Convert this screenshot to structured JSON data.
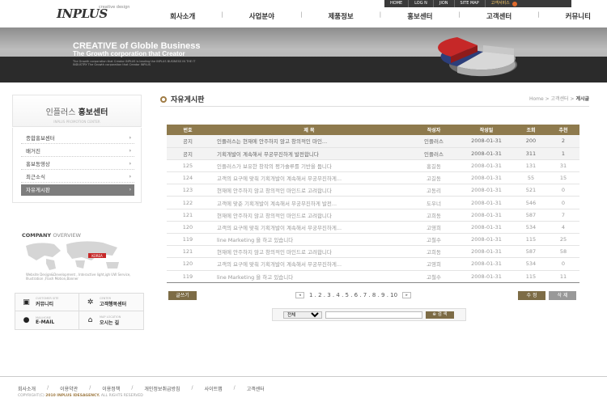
{
  "header": {
    "logo_main": "INPLUS",
    "logo_small": "creative design",
    "util": [
      "HOME",
      "LOG N",
      "JION",
      "SITE MAP",
      "고객서비스"
    ],
    "gnb": [
      "회사소개",
      "사업분야",
      "제품정보",
      "홍보센터",
      "고객센터",
      "커뮤니티"
    ]
  },
  "banner": {
    "title": "CREATIVE of Globle Business",
    "subtitle": "The Growth corporation that Creator",
    "tiny": "The Growth corporation that Creator INPLUS is leading the INPLUS BUSINESS IN THE IT INDUSTRY The Growth corporation that Creator INPLUS"
  },
  "sidebar": {
    "title_light": "인플러스",
    "title_bold": "홍보센터",
    "title_sub": "INPLUS PROMOTION CENTER",
    "items": [
      {
        "label": "종합홍보센터",
        "active": false
      },
      {
        "label": "배거진",
        "active": false
      },
      {
        "label": "홍보동영상",
        "active": false
      },
      {
        "label": "최근소식",
        "active": false
      },
      {
        "label": "자유게시판",
        "active": true
      }
    ],
    "company_bold": "COMPANY",
    "company_light": "OVERVIEW",
    "company_desc": "Website Design&Development , Interactive light,igh UW Service, Illustration ,Flash Motion,Banner",
    "korea_tag": "KOREA",
    "quick": [
      {
        "label": "커뮤니티",
        "sub": "CUSTOMER SITE",
        "icon": "community-icon"
      },
      {
        "label": "고객행복센터",
        "sub": "CENTER",
        "icon": "service-icon"
      },
      {
        "label": "E-MAIL",
        "sub": "MAILHOME",
        "icon": "email-icon"
      },
      {
        "label": "오시는 길",
        "sub": "MAP LOCATION",
        "icon": "home-icon"
      }
    ]
  },
  "main": {
    "title": "자유게시판",
    "breadcrumb": [
      "Home",
      "고객센터",
      "게시글"
    ],
    "columns": [
      "번호",
      "제 목",
      "작성자",
      "작성일",
      "조회",
      "추천"
    ],
    "rows": [
      {
        "no": "공지",
        "subject": "인플러스는 현재에 안주하지 않고 창의적인 마인...",
        "author": "인플러스",
        "date": "2008-01-31",
        "views": "200",
        "rec": "2",
        "notice": true
      },
      {
        "no": "공지",
        "subject": "기획개발이 계속해서 무궁무진하게 발전합니다",
        "author": "인플러스",
        "date": "2008-01-31",
        "views": "311",
        "rec": "1",
        "notice": true
      },
      {
        "no": "125",
        "subject": "인플러스가 보유한 창작의 평가솔루를 기반을 둡니다",
        "author": "홍길동",
        "date": "2008-01-31",
        "views": "131",
        "rec": "31"
      },
      {
        "no": "124",
        "subject": "고객의 요구에 맞춰 기획개발이 계속해서 무궁무진하게...",
        "author": "고길동",
        "date": "2008-01-31",
        "views": "55",
        "rec": "15"
      },
      {
        "no": "123",
        "subject": "현재에 안주하지 않고 창의적인 마인드로 고려합니다",
        "author": "고동리",
        "date": "2008-01-31",
        "views": "521",
        "rec": "0"
      },
      {
        "no": "122",
        "subject": "고객에 맞춘 기획개발이 계속해서 무궁무진하게 발전...",
        "author": "도우너",
        "date": "2008-01-31",
        "views": "546",
        "rec": "0"
      },
      {
        "no": "121",
        "subject": "현재에 안주하지 않고 창의적인 마인드로 고려합니다",
        "author": "고희동",
        "date": "2008-01-31",
        "views": "587",
        "rec": "7"
      },
      {
        "no": "120",
        "subject": "고객의 요구에 맞춰 기획개발이 계속해서 무궁무진하게...",
        "author": "고영희",
        "date": "2008-01-31",
        "views": "534",
        "rec": "4"
      },
      {
        "no": "119",
        "subject": "line Marketing 을 하고 있습니다",
        "author": "고철수",
        "date": "2008-01-31",
        "views": "115",
        "rec": "25"
      },
      {
        "no": "121",
        "subject": "현재에 안주하지 않고 창의적인 마인드로 고려합니다",
        "author": "고희동",
        "date": "2008-01-31",
        "views": "587",
        "rec": "58"
      },
      {
        "no": "120",
        "subject": "고객의 요구에 맞춰 기획개발이 계속해서 무궁무진하게...",
        "author": "고영희",
        "date": "2008-01-31",
        "views": "534",
        "rec": "0"
      },
      {
        "no": "119",
        "subject": "line Marketing 을 하고 있습니다",
        "author": "고철수",
        "date": "2008-01-31",
        "views": "115",
        "rec": "11"
      }
    ],
    "list_button": "글쓰기",
    "pages": "1 . 2 . 3 . 4 . 5 . 6 . 7 . 8 . 9 . 10",
    "write_button": "수 정",
    "delete_button": "삭 제",
    "search_option": "전체",
    "search_button": "검 색"
  },
  "footer": {
    "links": [
      "회사소개",
      "이용약관",
      "이용정책",
      "개인정보취급방침",
      "사이트맵",
      "고객센터"
    ],
    "copy_pre": "COPYRIGHT(C)",
    "copy_brand": "2010 INPLUS IDESAGENCY.",
    "copy_post": "ALL RIGHTS RESERVED"
  },
  "colors": {
    "accent": "#8e7a4d",
    "dark": "#2b2b2b"
  }
}
